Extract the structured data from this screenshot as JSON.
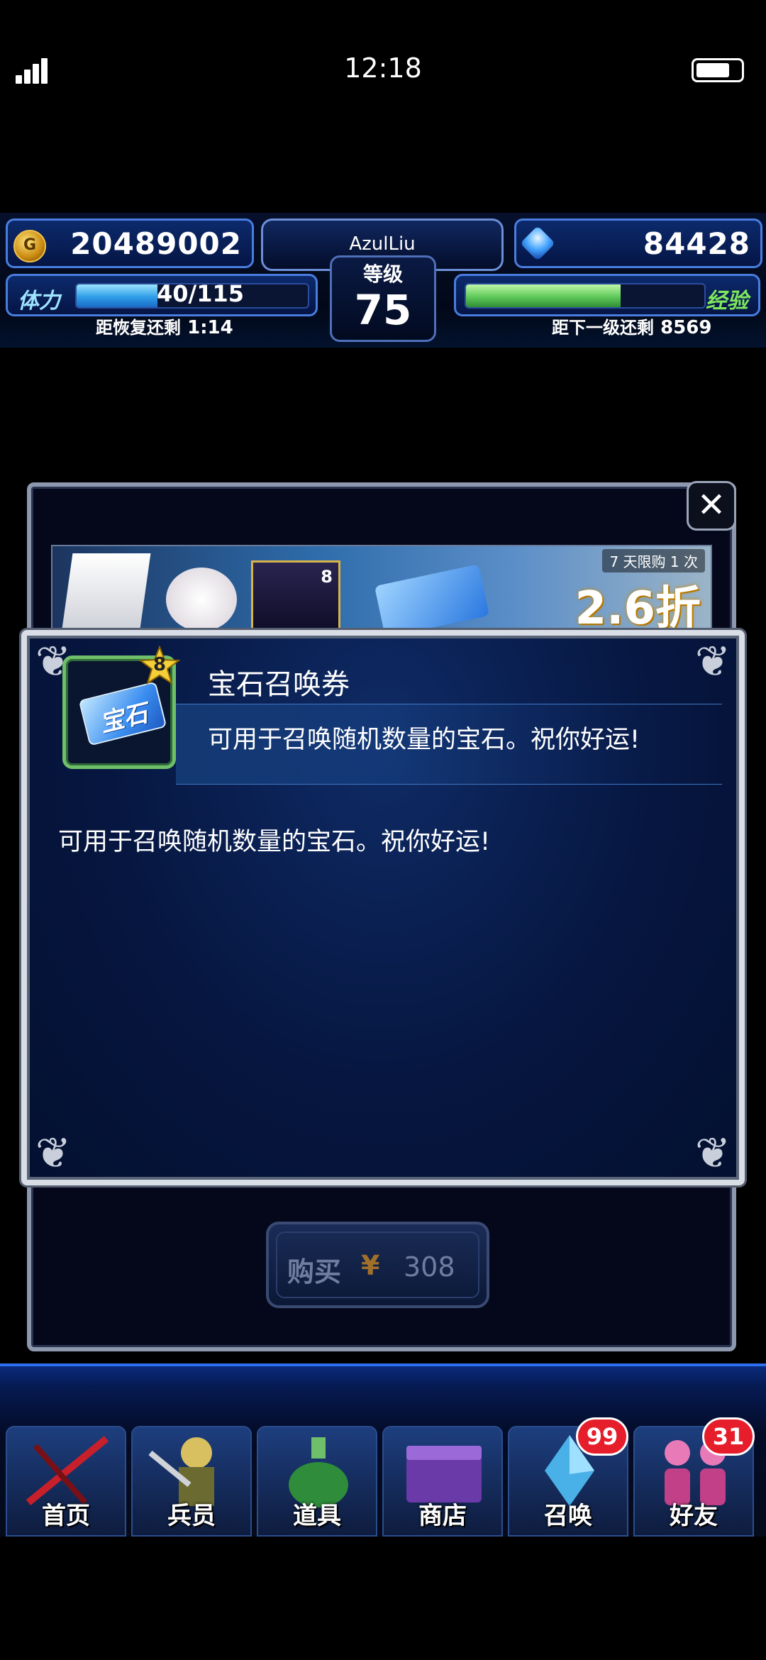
{
  "status_bar": {
    "time": "12:18"
  },
  "hud": {
    "gold": "20489002",
    "gems": "84428",
    "username": "AzulLiu",
    "level_label": "等级",
    "level": "75",
    "stamina_label": "体力",
    "stamina_value": "40/115",
    "stamina_fraction": 0.35,
    "stamina_recover_label": "距恢复还剩",
    "stamina_recover_time": "1:14",
    "exp_label": "经验",
    "exp_fraction": 0.65,
    "next_level_label": "距下一级还剩",
    "next_level_remaining": "8569"
  },
  "shop": {
    "banner_limit": "7 天限购 1 次",
    "banner_discount": "2.6折",
    "banner_card_rank": "8",
    "buy_label": "购买",
    "currency_symbol": "¥",
    "price": "308"
  },
  "item": {
    "icon_text": "宝石",
    "rank": "8",
    "name": "宝石召唤券",
    "short_desc": "可用于召唤随机数量的宝石。祝你好运!",
    "description": "可用于召唤随机数量的宝石。祝你好运!"
  },
  "nav": {
    "tabs": [
      {
        "label": "首页"
      },
      {
        "label": "兵员"
      },
      {
        "label": "道具"
      },
      {
        "label": "商店"
      },
      {
        "label": "召唤",
        "badge": "99"
      },
      {
        "label": "好友",
        "badge": "31"
      }
    ]
  },
  "colors": {
    "hud_border": "#4a7de0",
    "stamina_bar": "#2f9de8",
    "exp_bar": "#5fc95a",
    "exp_label": "#7fe85c",
    "badge": "#e61d2b",
    "item_frame": "#6fbf6a"
  }
}
